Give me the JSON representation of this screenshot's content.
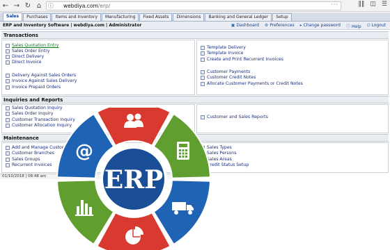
{
  "browser": {
    "url_host": "webdiya.com",
    "url_path": "/erp/"
  },
  "tabs": [
    "Sales",
    "Purchases",
    "Items and Inventory",
    "Manufacturing",
    "Fixed Assets",
    "Dimensions",
    "Banking and General Ledger",
    "Setup"
  ],
  "company": "ERP and Inventory Software | webdiya.com | Administrator",
  "top_links": [
    "Dashboard",
    "Preferences",
    "Change password",
    "Help",
    "Logout"
  ],
  "sections": {
    "transactions": "Transactions",
    "inquiries": "Inquiries and Reports",
    "maintenance": "Maintenance"
  },
  "transactions_left": [
    "Sales Quotation Entry",
    "Sales Order Entry",
    "Direct Delivery",
    "Direct Invoice",
    "Delivery Against Sales Orders",
    "Invoice Against Sales Delivery",
    "Invoice Prepaid Orders"
  ],
  "transactions_right": [
    "Template Delivery",
    "Template Invoice",
    "Create and Print Recurrent Invoices",
    "Customer Payments",
    "Customer Credit Notes",
    "Allocate Customer Payments or Credit Notes"
  ],
  "inquiries_left": [
    "Sales Quotation Inquiry",
    "Sales Order Inquiry",
    "Customer Transaction Inquiry",
    "Customer Allocation Inquiry"
  ],
  "inquiries_right": [
    "Customer and Sales Reports"
  ],
  "maintenance_left": [
    "Add and Manage Customers",
    "Customer Branches",
    "Sales Groups",
    "Recurrent Invoices"
  ],
  "maintenance_right": [
    "Sales Types",
    "Sales Persons",
    "Sales Areas",
    "Credit Status Setup"
  ],
  "status": "01/10/2018 | 08:48 am",
  "erp": {
    "label": "ERP",
    "segments": [
      {
        "icon": "users-icon",
        "color": "#d93a30"
      },
      {
        "icon": "calculator-icon",
        "color": "#5f9e2f"
      },
      {
        "icon": "truck-icon",
        "color": "#1f63b5"
      },
      {
        "icon": "pie-chart-icon",
        "color": "#d93a30"
      },
      {
        "icon": "bar-chart-icon",
        "color": "#5f9e2f"
      },
      {
        "icon": "at-sign-icon",
        "color": "#1f63b5"
      }
    ],
    "center_color": "#1a4f97"
  }
}
